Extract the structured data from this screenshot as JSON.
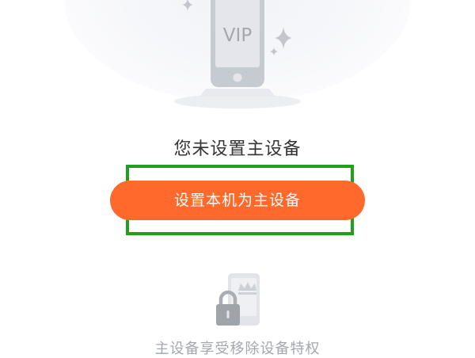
{
  "illustration": {
    "phone_badge": "VIP"
  },
  "main": {
    "title": "您未设置主设备",
    "primary_button_label": "设置本机为主设备",
    "feature_text": "主设备享受移除设备特权"
  },
  "colors": {
    "primary_button": "#ff6a2c",
    "highlight_border": "#1aa31a",
    "title_text": "#333333",
    "muted_text": "#a3a7ae"
  },
  "icons": {
    "hero": "vip-phone-icon",
    "sparkles": "sparkle-icon",
    "feature": "phone-lock-crown-icon"
  }
}
